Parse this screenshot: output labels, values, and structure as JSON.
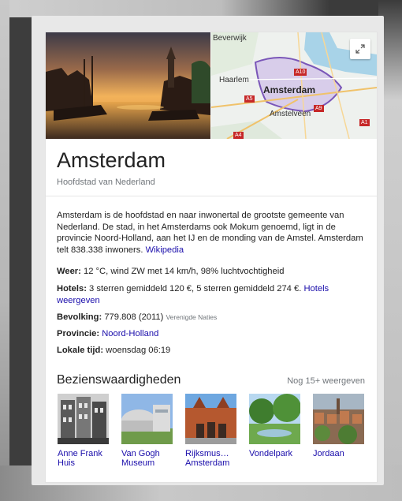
{
  "entity": {
    "title": "Amsterdam",
    "subtitle": "Hoofdstad van Nederland"
  },
  "map": {
    "labels": {
      "beverwijk": "Beverwijk",
      "haarlem": "Haarlem",
      "amsterdam": "Amsterdam",
      "amstelveen": "Amstelveen"
    },
    "shields": {
      "a10": "A10",
      "a5": "A5",
      "a9": "A9",
      "a1": "A1",
      "a4": "A4"
    }
  },
  "description": {
    "text": "Amsterdam is de hoofdstad en naar inwonertal de grootste gemeente van Nederland. De stad, in het Amsterdams ook Mokum genoemd, ligt in de provincie Noord-Holland, aan het IJ en de monding van de Amstel. Amsterdam telt 838.338 inwoners.",
    "source_link": "Wikipedia"
  },
  "facts": {
    "weather": {
      "label": "Weer:",
      "value": "12 °C, wind ZW met 14 km/h, 98% luchtvochtigheid"
    },
    "hotels": {
      "label": "Hotels:",
      "value": "3 sterren gemiddeld 120 €, 5 sterren gemiddeld 274 €.",
      "link": "Hotels weergeven"
    },
    "population": {
      "label": "Bevolking:",
      "value": "779.808 (2011)",
      "source": "Verenigde Naties"
    },
    "province": {
      "label": "Provincie:",
      "link": "Noord-Holland"
    },
    "local_time": {
      "label": "Lokale tijd:",
      "value": "woensdag 06:19"
    }
  },
  "sights": {
    "title": "Bezienswaardigheden",
    "more": "Nog 15+ weergeven",
    "items": [
      {
        "label": "Anne Frank Huis"
      },
      {
        "label": "Van Gogh Museum"
      },
      {
        "label": "Rijksmus… Amsterdam"
      },
      {
        "label": "Vondelpark"
      },
      {
        "label": "Jordaan"
      }
    ]
  },
  "colors": {
    "link": "#1a0dab",
    "muted": "#70757a",
    "highway": "#c62828"
  }
}
